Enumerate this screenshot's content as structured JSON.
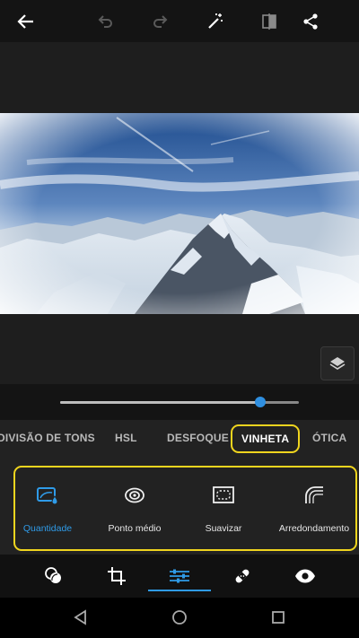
{
  "toolbar": {
    "back": "arrow-left-icon",
    "undo": "undo-icon",
    "redo": "redo-icon",
    "auto_fix": "magic-wand-icon",
    "compare": "compare-icon",
    "share": "share-icon"
  },
  "slider": {
    "value": 0.84,
    "accent": "#2f8fe0"
  },
  "tabs": [
    {
      "label": "DIVISÃO DE TONS"
    },
    {
      "label": "HSL"
    },
    {
      "label": "DESFOQUE"
    },
    {
      "label": "VINHETA"
    },
    {
      "label": "ÓTICA"
    }
  ],
  "active_tab": "VINHETA",
  "tools": [
    {
      "label": "Quantidade",
      "icon": "vignette-amount-icon"
    },
    {
      "label": "Ponto médio",
      "icon": "midpoint-icon"
    },
    {
      "label": "Suavizar",
      "icon": "feather-icon"
    },
    {
      "label": "Arredondamento",
      "icon": "roundness-icon"
    }
  ],
  "active_tool": "Quantidade",
  "bottom_nav": [
    "looks-icon",
    "crop-icon",
    "adjust-icon",
    "heal-icon",
    "preview-icon"
  ],
  "colors": {
    "highlight": "#f0d51e",
    "accent": "#2f9be8"
  }
}
